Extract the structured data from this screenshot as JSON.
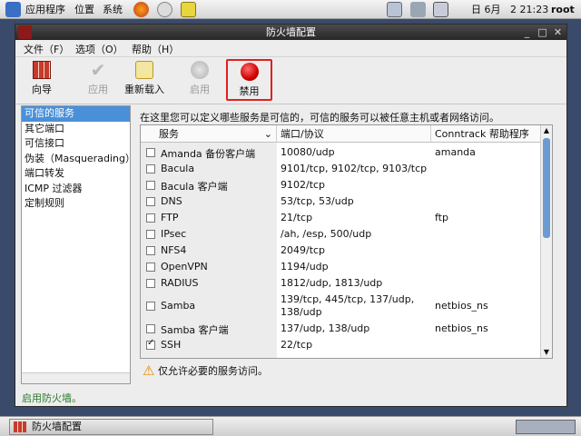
{
  "top_panel": {
    "apps_menu": "应用程序",
    "places_menu": "位置",
    "system_menu": "系统",
    "date": "日 6月",
    "time": "2 21:23",
    "user": "root"
  },
  "window": {
    "title": "防火墙配置",
    "menus": [
      "文件（F）",
      "选项（O）",
      "帮助（H）"
    ],
    "toolbar": {
      "wizard": "向导",
      "apply": "应用",
      "reload": "重新载入",
      "enable": "启用",
      "disable": "禁用"
    },
    "nav": [
      "可信的服务",
      "其它端口",
      "可信接口",
      "伪装（Masquerading）",
      "端口转发",
      "ICMP 过滤器",
      "定制规则"
    ],
    "description": "在这里您可以定义哪些服务是可信的，可信的服务可以被任意主机或者网络访问。",
    "table": {
      "headers": [
        "服务",
        "端口/协议",
        "Conntrack 帮助程序"
      ],
      "rows": [
        {
          "service": "Amanda 备份客户端",
          "ports": "10080/udp",
          "helper": "amanda",
          "checked": false
        },
        {
          "service": "Bacula",
          "ports": "9101/tcp, 9102/tcp, 9103/tcp",
          "helper": "",
          "checked": false
        },
        {
          "service": "Bacula 客户端",
          "ports": "9102/tcp",
          "helper": "",
          "checked": false
        },
        {
          "service": "DNS",
          "ports": "53/tcp, 53/udp",
          "helper": "",
          "checked": false
        },
        {
          "service": "FTP",
          "ports": "21/tcp",
          "helper": "ftp",
          "checked": false
        },
        {
          "service": "IPsec",
          "ports": "/ah, /esp, 500/udp",
          "helper": "",
          "checked": false
        },
        {
          "service": "NFS4",
          "ports": "2049/tcp",
          "helper": "",
          "checked": false
        },
        {
          "service": "OpenVPN",
          "ports": "1194/udp",
          "helper": "",
          "checked": false
        },
        {
          "service": "RADIUS",
          "ports": "1812/udp, 1813/udp",
          "helper": "",
          "checked": false
        },
        {
          "service": "Samba",
          "ports": "139/tcp, 445/tcp, 137/udp,",
          "ports2": "138/udp",
          "helper": "netbios_ns",
          "checked": false
        },
        {
          "service": "Samba 客户端",
          "ports": "137/udp, 138/udp",
          "helper": "netbios_ns",
          "checked": false
        },
        {
          "service": "SSH",
          "ports": "22/tcp",
          "helper": "",
          "checked": true
        }
      ]
    },
    "warning": "仅允许必要的服务访问。",
    "status": "启用防火墙。"
  },
  "taskbar": {
    "task": "防火墙配置"
  }
}
